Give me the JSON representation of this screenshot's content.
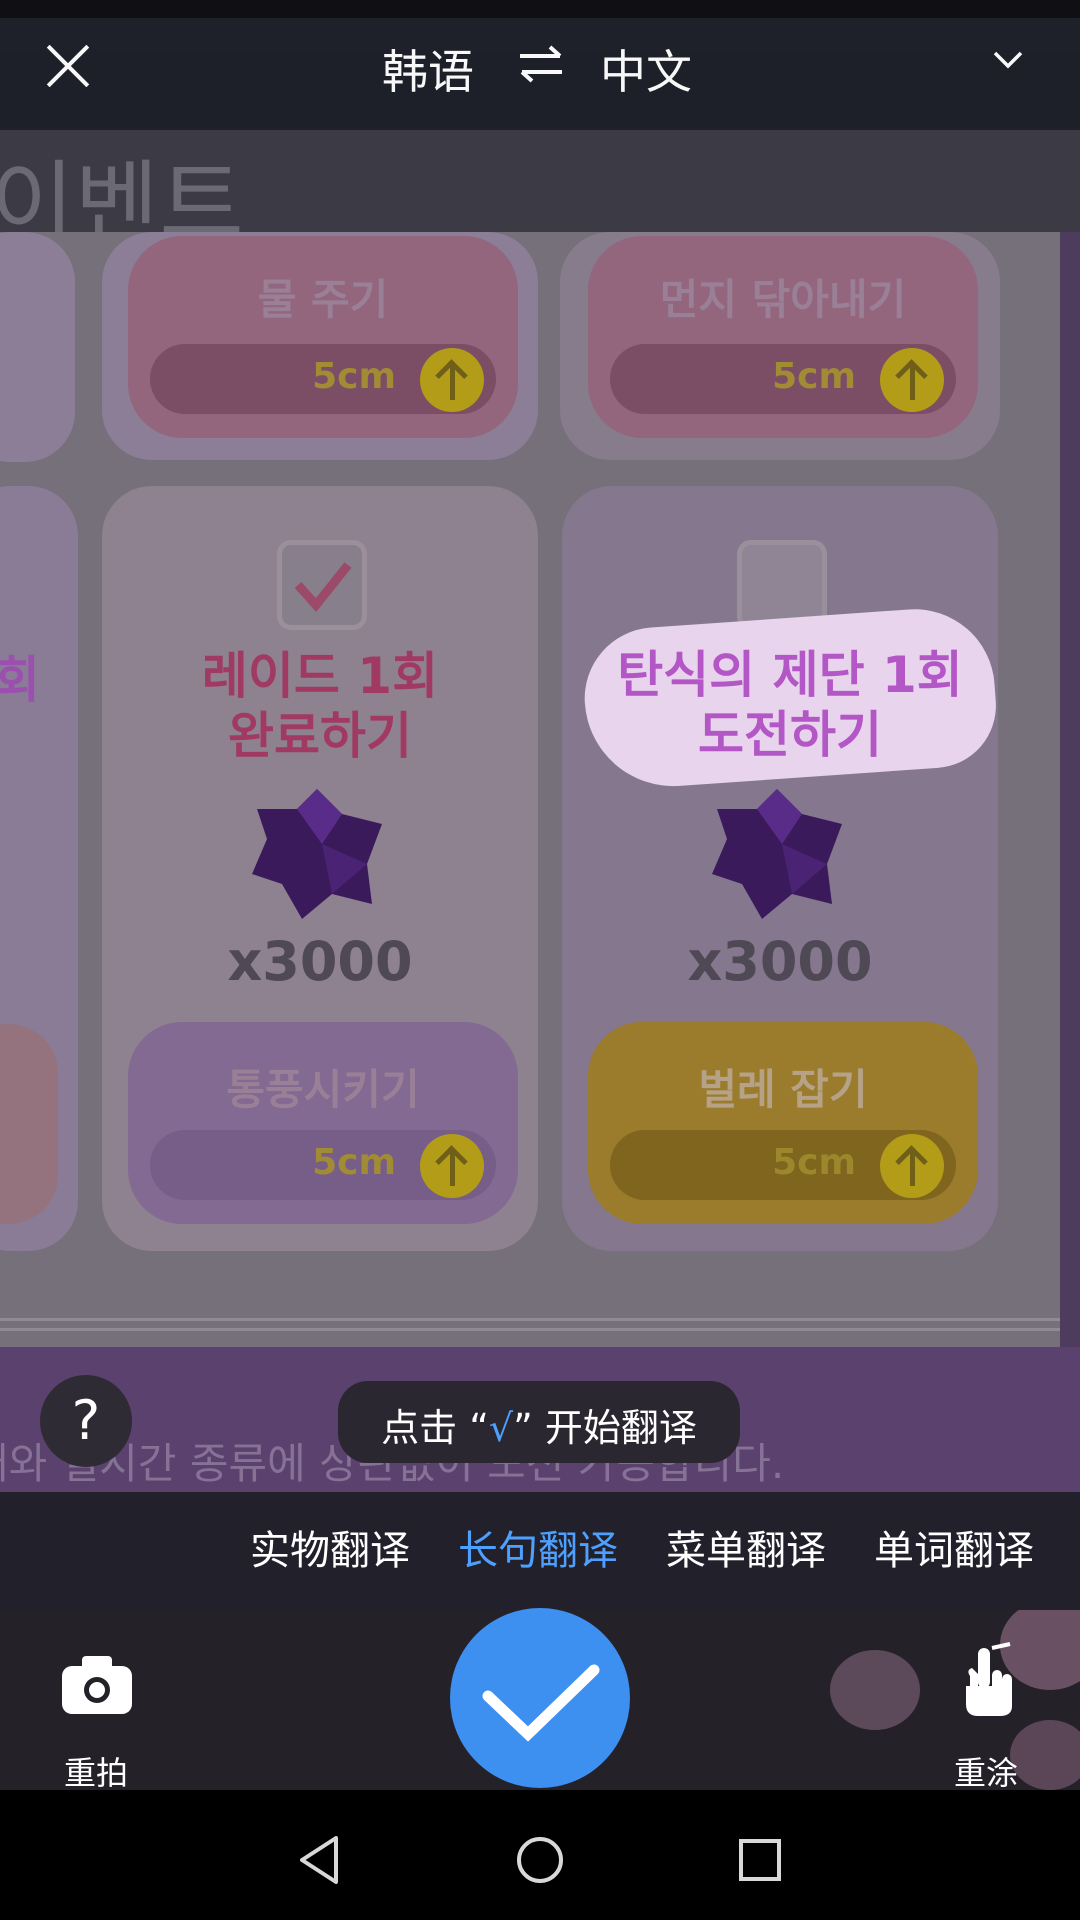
{
  "topbar": {
    "source_language": "韩语",
    "target_language": "中文",
    "close_icon": "close-icon",
    "swap_icon": "swap-arrows-icon",
    "dropdown_icon": "chevron-down-icon"
  },
  "photo": {
    "header_text": "이벤트",
    "top_cards": [
      {
        "title": "물 주기",
        "progress_label": "5cm"
      },
      {
        "title": "먼지 닦아내기",
        "progress_label": "5cm"
      }
    ],
    "tasks": [
      {
        "text_line1": "레이드 1회",
        "text_line2": "완료하기",
        "reward": "x3000",
        "checked": true
      },
      {
        "text_line1": "탄식의 제단 1회",
        "text_line2": "도전하기",
        "reward": "x3000",
        "checked": false
      }
    ],
    "bottom_cards": [
      {
        "title": "통풍시키기",
        "progress_label": "5cm"
      },
      {
        "title": "벌레 잡기",
        "progress_label": "5cm"
      }
    ],
    "left_partial_text": "회",
    "footer_text": "대와 실시간 종류에 상관없이 도전 가능합니다."
  },
  "help": {
    "label": "?"
  },
  "toast": {
    "prefix": "点击 “",
    "check": "√",
    "suffix": "” 开始翻译"
  },
  "mode_tabs": [
    {
      "label": "实物翻译",
      "active": false
    },
    {
      "label": "长句翻译",
      "active": true
    },
    {
      "label": "菜单翻译",
      "active": false
    },
    {
      "label": "单词翻译",
      "active": false
    }
  ],
  "actions": {
    "retake_label": "重拍",
    "retake_icon": "camera-icon",
    "confirm_icon": "checkmark-icon",
    "repaint_label": "重涂",
    "repaint_icon": "hand-pointer-icon"
  },
  "colors": {
    "accent": "#3d8ff0",
    "active_tab": "#4ea0ff",
    "highlight_text": "#b457c6"
  },
  "navbar": {
    "back_icon": "back-triangle-icon",
    "home_icon": "home-circle-icon",
    "recents_icon": "recents-square-icon"
  }
}
